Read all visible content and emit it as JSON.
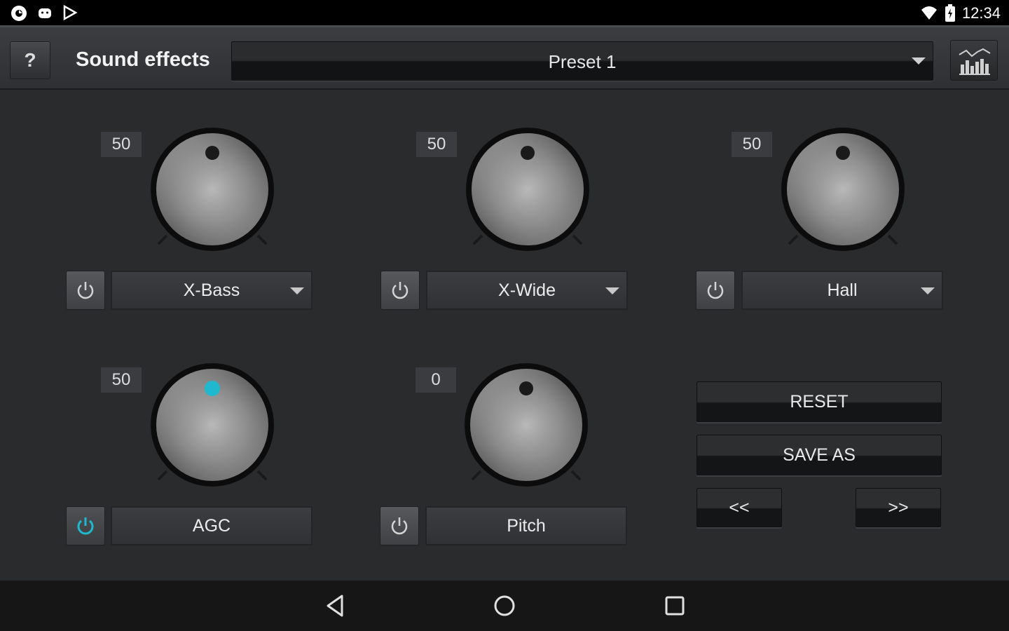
{
  "status_bar": {
    "time": "12:34"
  },
  "header": {
    "help_label": "?",
    "title": "Sound effects",
    "preset": "Preset 1"
  },
  "effects": [
    {
      "name": "X-Bass",
      "value": "50",
      "enabled": false,
      "has_dropdown": true
    },
    {
      "name": "X-Wide",
      "value": "50",
      "enabled": false,
      "has_dropdown": true
    },
    {
      "name": "Hall",
      "value": "50",
      "enabled": false,
      "has_dropdown": true
    },
    {
      "name": "AGC",
      "value": "50",
      "enabled": true,
      "has_dropdown": false
    },
    {
      "name": "Pitch",
      "value": "0",
      "enabled": false,
      "has_dropdown": false
    }
  ],
  "actions": {
    "reset": "RESET",
    "save_as": "SAVE AS",
    "prev": "<<",
    "next": ">>"
  },
  "colors": {
    "accent": "#1fb8cf",
    "background": "#2a2b2d"
  }
}
